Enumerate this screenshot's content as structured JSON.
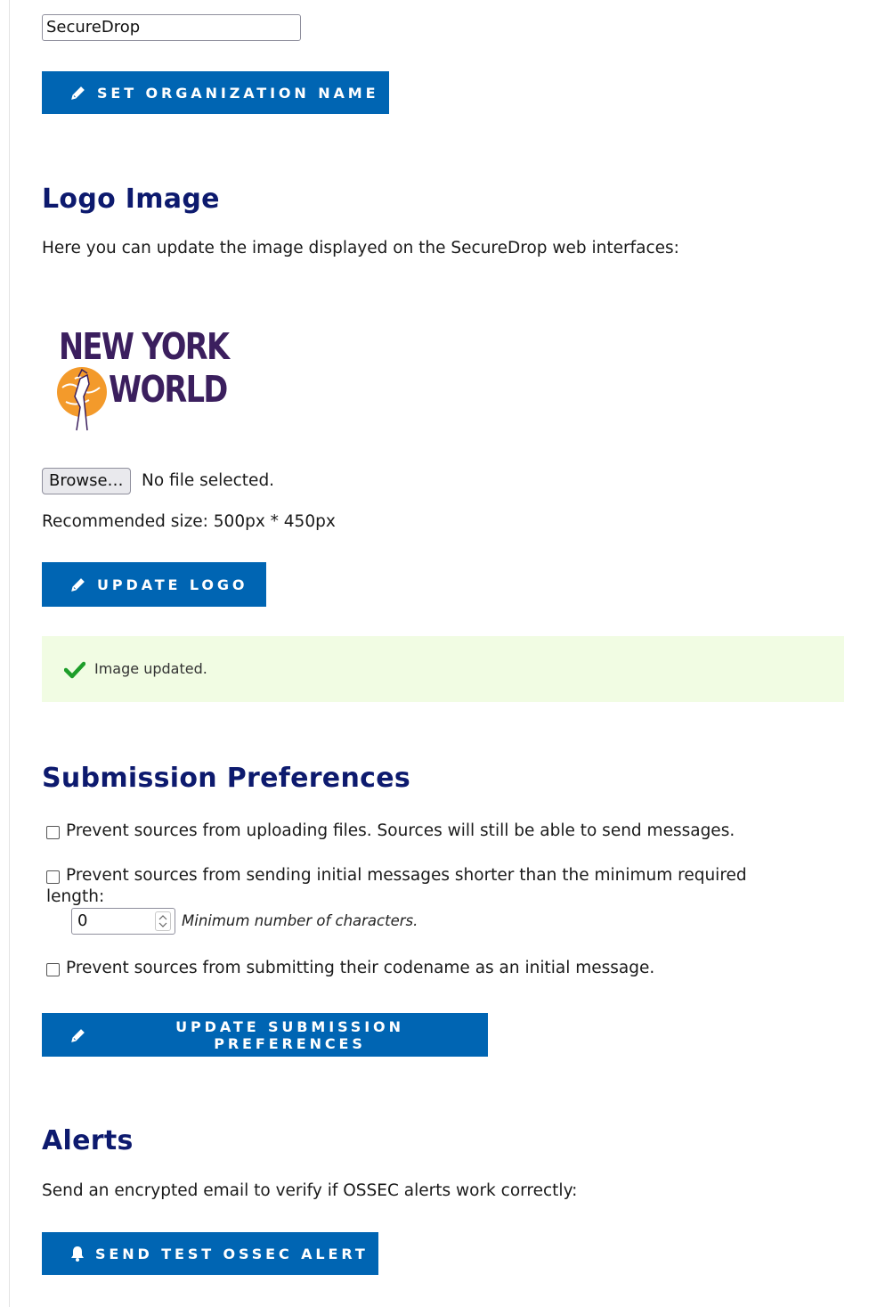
{
  "organization": {
    "name_value": "SecureDrop",
    "set_button_label": "SET ORGANIZATION NAME"
  },
  "logo": {
    "heading": "Logo Image",
    "description": "Here you can update the image displayed on the SecureDrop web interfaces:",
    "image_text_line1": "NEW YORK",
    "image_text_line2": "WORLD",
    "browse_label": "Browse…",
    "no_file_label": "No file selected.",
    "recommended_size": "Recommended size: 500px * 450px",
    "update_button_label": "UPDATE LOGO",
    "flash_message": "Image updated."
  },
  "submission": {
    "heading": "Submission Preferences",
    "prevent_uploads_label": "Prevent sources from uploading files. Sources will still be able to send messages.",
    "min_length_label_line1": "Prevent sources from sending initial messages shorter than the minimum required",
    "min_length_label_line2": "length:",
    "min_length_value": "0",
    "min_length_hint": "Minimum number of characters.",
    "prevent_codename_label": "Prevent sources from submitting their codename as an initial message.",
    "update_button_label": "UPDATE SUBMISSION PREFERENCES"
  },
  "alerts": {
    "heading": "Alerts",
    "description": "Send an encrypted email to verify if OSSEC alerts work correctly:",
    "send_button_label": "SEND TEST OSSEC ALERT"
  },
  "colors": {
    "button_blue": "#0065b3",
    "heading_navy": "#0d1a6e",
    "flash_bg": "#f1fce3",
    "check_green": "#1e9e2a",
    "logo_purple": "#3b1f5e",
    "logo_orange": "#f39a2b"
  },
  "icons": {
    "pencil": "pencil-icon",
    "bell": "bell-icon",
    "check": "check-icon"
  }
}
